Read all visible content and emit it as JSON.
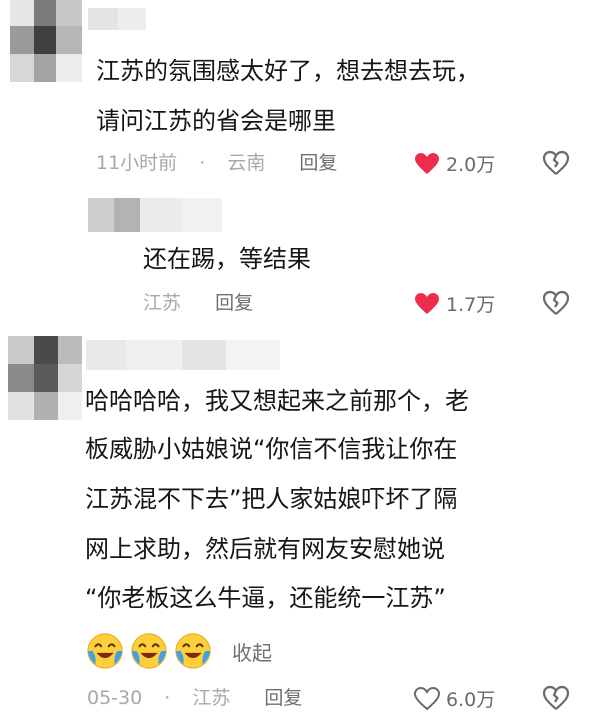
{
  "comments": [
    {
      "lines": [
        "江苏的氛围感太好了，想去想去玩，",
        "请问江苏的省会是哪里"
      ],
      "time": "11小时前",
      "location": "云南",
      "reply": "回复",
      "likes": "2.0万",
      "liked": true
    },
    {
      "lines": [
        "还在踢，等结果"
      ],
      "location": "江苏",
      "reply": "回复",
      "likes": "1.7万",
      "liked": true
    },
    {
      "lines": [
        "哈哈哈哈，我又想起来之前那个，老",
        "板威胁小姑娘说“你信不信我让你在",
        "江苏混不下去”把人家姑娘吓坏了隔",
        "网上求助，然后就有网友安慰她说",
        "“你老板这么牛逼，还能统一江苏”"
      ],
      "collapse": "收起",
      "time": "05-30",
      "location": "江苏",
      "reply": "回复",
      "likes": "6.0万",
      "liked": false
    }
  ],
  "meta_separator": "·",
  "colors": {
    "like_active": "#ee2d4d",
    "muted": "#a8a8a8"
  },
  "icons": {
    "like": "heart-icon",
    "dislike": "broken-heart-icon",
    "emoji": "crying-laughing-emoji"
  }
}
